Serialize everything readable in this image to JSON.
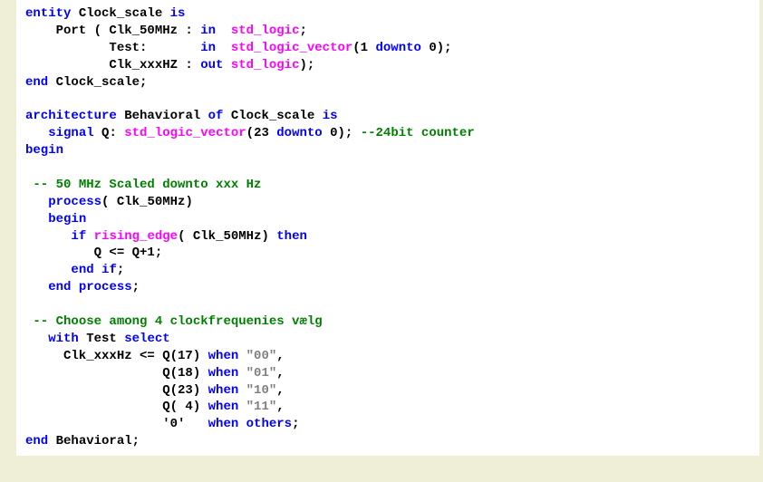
{
  "lines": [
    {
      "segments": [
        {
          "t": "entity",
          "c": "kw"
        },
        {
          "t": " Clock_scale ",
          "c": "id"
        },
        {
          "t": "is",
          "c": "kw"
        }
      ]
    },
    {
      "segments": [
        {
          "t": "    Port ( Clk_50MHz : ",
          "c": "id"
        },
        {
          "t": "in",
          "c": "kw"
        },
        {
          "t": "  ",
          "c": "id"
        },
        {
          "t": "std_logic",
          "c": "type"
        },
        {
          "t": ";",
          "c": "id"
        }
      ]
    },
    {
      "segments": [
        {
          "t": "           Test:       ",
          "c": "id"
        },
        {
          "t": "in",
          "c": "kw"
        },
        {
          "t": "  ",
          "c": "id"
        },
        {
          "t": "std_logic_vector",
          "c": "type"
        },
        {
          "t": "(1 ",
          "c": "id"
        },
        {
          "t": "downto",
          "c": "kw"
        },
        {
          "t": " 0);",
          "c": "id"
        }
      ]
    },
    {
      "segments": [
        {
          "t": "           Clk_xxxHZ : ",
          "c": "id"
        },
        {
          "t": "out",
          "c": "kw"
        },
        {
          "t": " ",
          "c": "id"
        },
        {
          "t": "std_logic",
          "c": "type"
        },
        {
          "t": ");",
          "c": "id"
        }
      ]
    },
    {
      "segments": [
        {
          "t": "end",
          "c": "kw"
        },
        {
          "t": " Clock_scale;",
          "c": "id"
        }
      ]
    },
    {
      "segments": [
        {
          "t": "",
          "c": "id"
        }
      ]
    },
    {
      "segments": [
        {
          "t": "architecture",
          "c": "kw"
        },
        {
          "t": " Behavioral ",
          "c": "id"
        },
        {
          "t": "of",
          "c": "kw"
        },
        {
          "t": " Clock_scale ",
          "c": "id"
        },
        {
          "t": "is",
          "c": "kw"
        }
      ]
    },
    {
      "segments": [
        {
          "t": "   ",
          "c": "id"
        },
        {
          "t": "signal",
          "c": "kw"
        },
        {
          "t": " Q: ",
          "c": "id"
        },
        {
          "t": "std_logic_vector",
          "c": "type"
        },
        {
          "t": "(23 ",
          "c": "id"
        },
        {
          "t": "downto",
          "c": "kw"
        },
        {
          "t": " 0); ",
          "c": "id"
        },
        {
          "t": "--24bit counter",
          "c": "cmt"
        }
      ]
    },
    {
      "segments": [
        {
          "t": "begin",
          "c": "kw"
        }
      ]
    },
    {
      "segments": [
        {
          "t": "",
          "c": "id"
        }
      ]
    },
    {
      "segments": [
        {
          "t": " ",
          "c": "id"
        },
        {
          "t": "-- 50 MHz Scaled downto xxx Hz",
          "c": "cmt"
        }
      ]
    },
    {
      "segments": [
        {
          "t": "   ",
          "c": "id"
        },
        {
          "t": "process",
          "c": "kw"
        },
        {
          "t": "( Clk_50MHz)",
          "c": "id"
        }
      ]
    },
    {
      "segments": [
        {
          "t": "   ",
          "c": "id"
        },
        {
          "t": "begin",
          "c": "kw"
        }
      ]
    },
    {
      "segments": [
        {
          "t": "      ",
          "c": "id"
        },
        {
          "t": "if",
          "c": "kw"
        },
        {
          "t": " ",
          "c": "id"
        },
        {
          "t": "rising_edge",
          "c": "type"
        },
        {
          "t": "( Clk_50MHz) ",
          "c": "id"
        },
        {
          "t": "then",
          "c": "kw"
        }
      ]
    },
    {
      "segments": [
        {
          "t": "         Q <= Q+1;",
          "c": "id"
        }
      ]
    },
    {
      "segments": [
        {
          "t": "      ",
          "c": "id"
        },
        {
          "t": "end",
          "c": "kw"
        },
        {
          "t": " ",
          "c": "id"
        },
        {
          "t": "if",
          "c": "kw"
        },
        {
          "t": ";",
          "c": "id"
        }
      ]
    },
    {
      "segments": [
        {
          "t": "   ",
          "c": "id"
        },
        {
          "t": "end",
          "c": "kw"
        },
        {
          "t": " ",
          "c": "id"
        },
        {
          "t": "process",
          "c": "kw"
        },
        {
          "t": ";",
          "c": "id"
        }
      ]
    },
    {
      "segments": [
        {
          "t": "",
          "c": "id"
        }
      ]
    },
    {
      "segments": [
        {
          "t": " ",
          "c": "id"
        },
        {
          "t": "-- Choose among 4 clockfrequenies vælg",
          "c": "cmt"
        }
      ]
    },
    {
      "segments": [
        {
          "t": "   ",
          "c": "id"
        },
        {
          "t": "with",
          "c": "kw"
        },
        {
          "t": " Test ",
          "c": "id"
        },
        {
          "t": "select",
          "c": "kw"
        }
      ]
    },
    {
      "segments": [
        {
          "t": "     Clk_xxxHz <= Q(17) ",
          "c": "id"
        },
        {
          "t": "when",
          "c": "kw"
        },
        {
          "t": " ",
          "c": "id"
        },
        {
          "t": "\"00\"",
          "c": "str"
        },
        {
          "t": ",",
          "c": "id"
        }
      ]
    },
    {
      "segments": [
        {
          "t": "                  Q(18) ",
          "c": "id"
        },
        {
          "t": "when",
          "c": "kw"
        },
        {
          "t": " ",
          "c": "id"
        },
        {
          "t": "\"01\"",
          "c": "str"
        },
        {
          "t": ",",
          "c": "id"
        }
      ]
    },
    {
      "segments": [
        {
          "t": "                  Q(23) ",
          "c": "id"
        },
        {
          "t": "when",
          "c": "kw"
        },
        {
          "t": " ",
          "c": "id"
        },
        {
          "t": "\"10\"",
          "c": "str"
        },
        {
          "t": ",",
          "c": "id"
        }
      ]
    },
    {
      "segments": [
        {
          "t": "                  Q( 4) ",
          "c": "id"
        },
        {
          "t": "when",
          "c": "kw"
        },
        {
          "t": " ",
          "c": "id"
        },
        {
          "t": "\"11\"",
          "c": "str"
        },
        {
          "t": ",",
          "c": "id"
        }
      ]
    },
    {
      "segments": [
        {
          "t": "                  '0'   ",
          "c": "id"
        },
        {
          "t": "when",
          "c": "kw"
        },
        {
          "t": " ",
          "c": "id"
        },
        {
          "t": "others",
          "c": "kw"
        },
        {
          "t": ";",
          "c": "id"
        }
      ]
    },
    {
      "segments": [
        {
          "t": "end",
          "c": "kw"
        },
        {
          "t": " Behavioral;",
          "c": "id"
        }
      ]
    }
  ]
}
